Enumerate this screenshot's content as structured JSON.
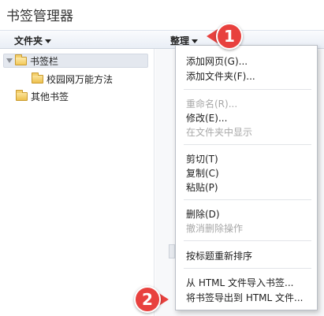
{
  "header": {
    "title": "书签管理器"
  },
  "toolbar": {
    "folders_label": "文件夹",
    "organize_label": "整理"
  },
  "tree": {
    "items": [
      {
        "label": "书签栏"
      },
      {
        "label": "校园网万能方法"
      },
      {
        "label": "其他书签"
      }
    ]
  },
  "menu": {
    "add_page": "添加网页(G)...",
    "add_folder": "添加文件夹(F)...",
    "rename": "重命名(R)...",
    "edit": "修改(E)...",
    "show_in_folder": "在文件夹中显示",
    "cut": "剪切(T)",
    "copy": "复制(C)",
    "paste": "粘贴(P)",
    "delete": "删除(D)",
    "undo_delete": "撤消删除操作",
    "sort_by_title": "按标题重新排序",
    "import_html": "从 HTML 文件导入书签...",
    "export_html": "将书签导出到 HTML 文件..."
  },
  "annotations": {
    "step1": "1",
    "step2": "2"
  },
  "colors": {
    "badge": "#e8413e",
    "selected_row": "#e4e8ef",
    "toolbar": "#e9eef6"
  }
}
